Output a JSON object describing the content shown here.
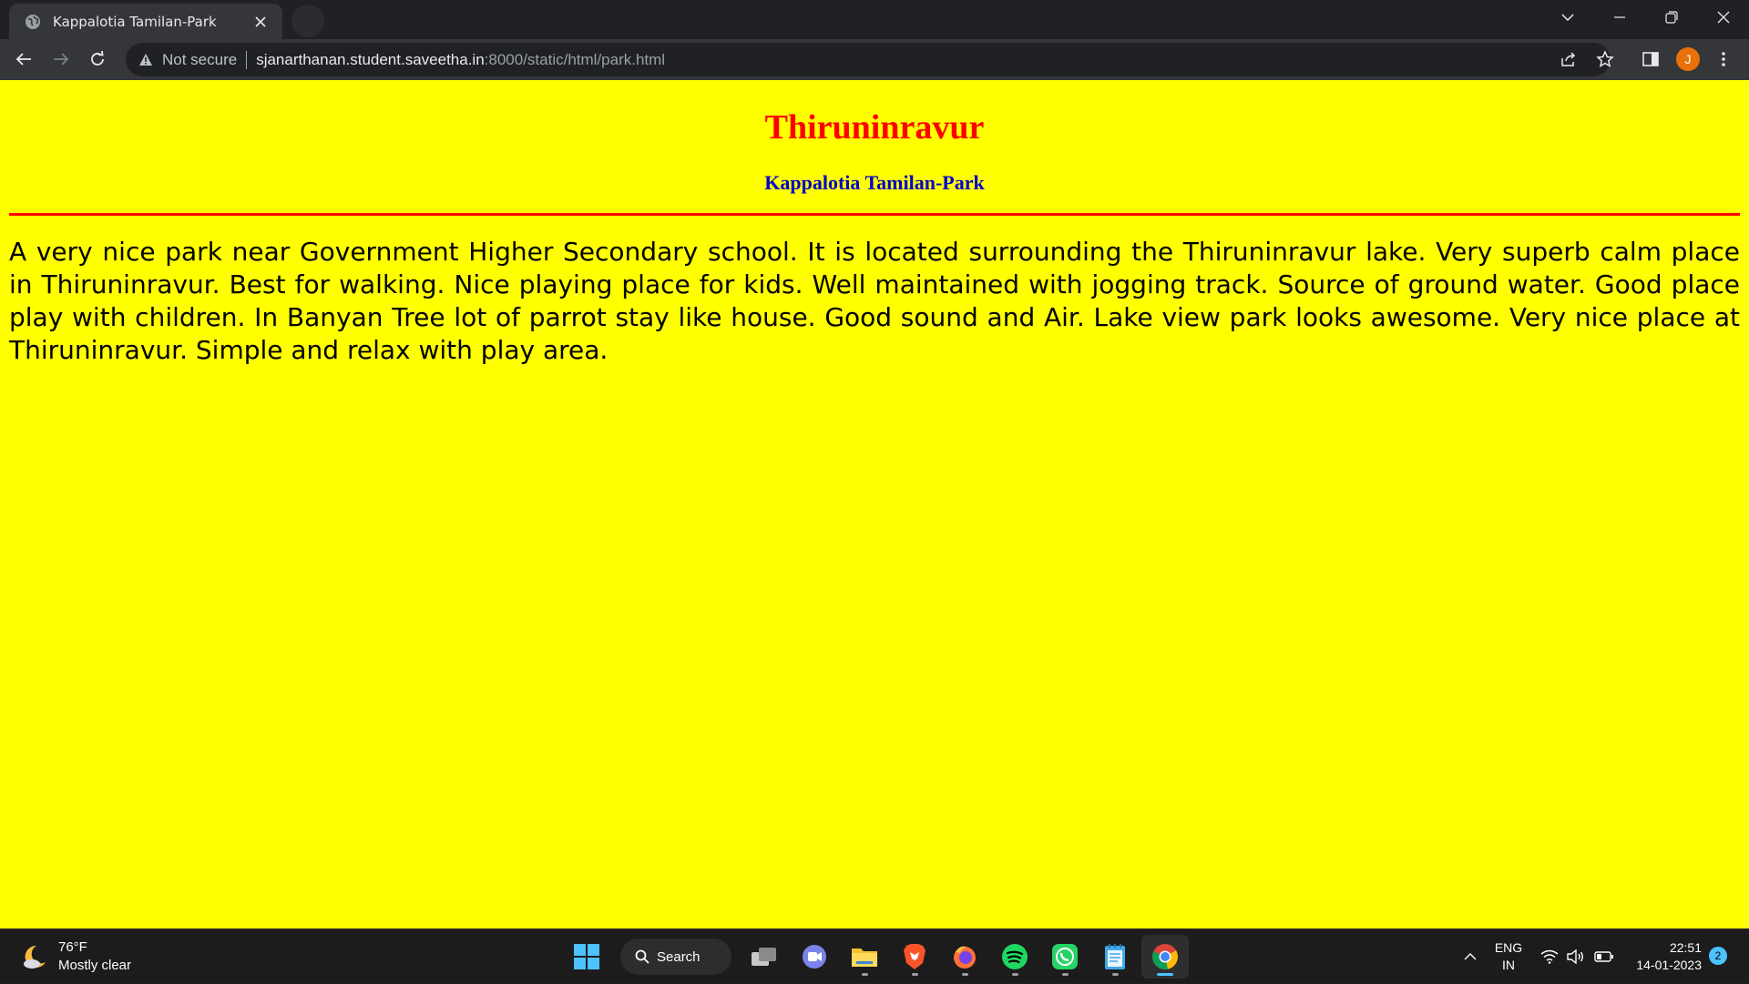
{
  "browser": {
    "tab_title": "Kappalotia Tamilan-Park",
    "security_label": "Not secure",
    "url_host": "sjanarthanan.student.saveetha.in",
    "url_path": ":8000/static/html/park.html",
    "profile_initial": "J",
    "icons": [
      "globe-icon",
      "close-icon",
      "back-icon",
      "forward-icon",
      "reload-icon",
      "warning-icon",
      "share-icon",
      "star-icon",
      "side-panel-icon",
      "menu-icon"
    ]
  },
  "page": {
    "background": "#ffff00",
    "heading": "Thiruninravur",
    "heading_color": "#ff0000",
    "subheading": "Kappalotia Tamilan-Park",
    "subheading_color": "#0000cc",
    "rule_color": "#ff0000",
    "paragraph": "A very nice park near Government Higher Secondary school. It is located surrounding the Thiruninravur lake. Very superb calm place in Thiruninravur. Best for walking. Nice playing place for kids. Well maintained with jogging track. Source of ground water. Good place play with children. In Banyan Tree lot of parrot stay like house. Good sound and Air. Lake view park looks awesome. Very nice place at Thiruninravur. Simple and relax with play area."
  },
  "taskbar": {
    "weather_temp": "76°F",
    "weather_desc": "Mostly clear",
    "search_label": "Search",
    "apps": [
      "start",
      "search",
      "task-view",
      "teams",
      "file-explorer",
      "brave",
      "firefox",
      "spotify",
      "whatsapp",
      "notepad",
      "chrome"
    ],
    "lang_top": "ENG",
    "lang_bottom": "IN",
    "time": "22:51",
    "date": "14-01-2023",
    "notification_count": "2"
  }
}
